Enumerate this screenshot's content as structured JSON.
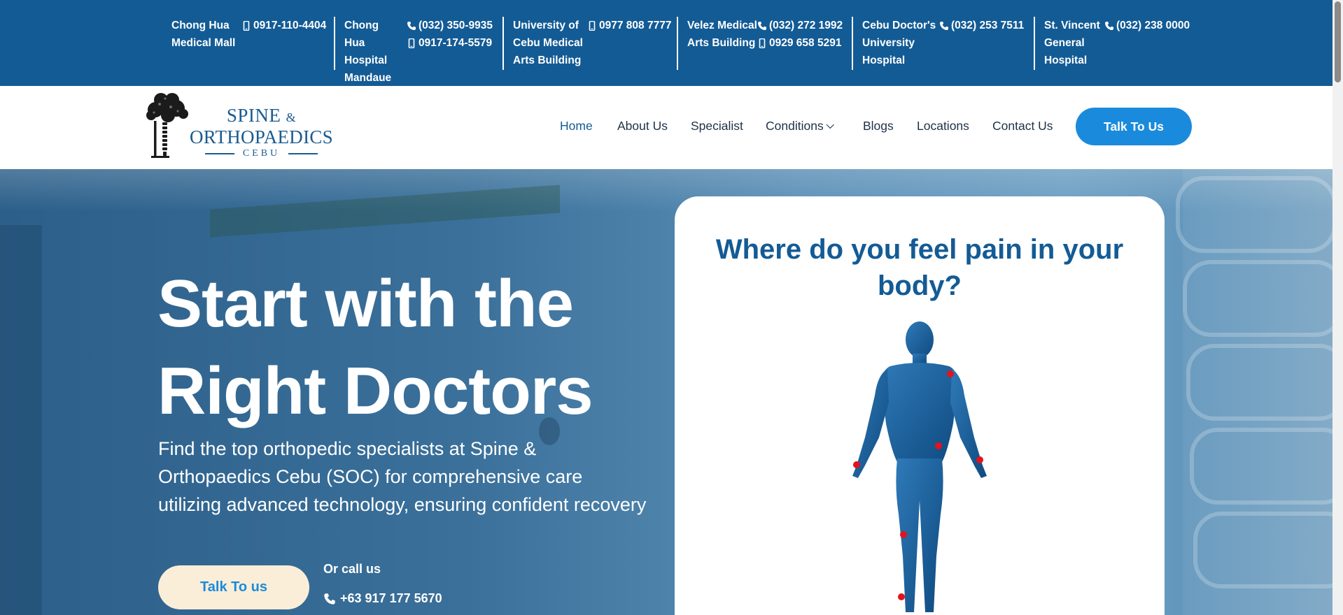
{
  "locations": [
    {
      "name": "Chong Hua Medical Mall",
      "phones": [
        {
          "icon": "mobile-icon",
          "number": "0917-110-4404"
        }
      ]
    },
    {
      "name": "Chong Hua Hospital Mandaue",
      "phones": [
        {
          "icon": "phone-icon",
          "number": "(032) 350-9935"
        },
        {
          "icon": "mobile-icon",
          "number": "0917-174-5579"
        }
      ]
    },
    {
      "name": "University of Cebu Medical Arts Building",
      "phones": [
        {
          "icon": "mobile-icon",
          "number": "0977 808 7777"
        }
      ]
    },
    {
      "name": "Velez Medical Arts Building",
      "phones": [
        {
          "icon": "phone-icon",
          "number": "(032) 272 1992"
        },
        {
          "icon": "mobile-icon",
          "number": "0929 658 5291"
        }
      ]
    },
    {
      "name": "Cebu Doctor's University Hospital",
      "phones": [
        {
          "icon": "phone-icon",
          "number": "(032) 253 7511"
        }
      ]
    },
    {
      "name": "St. Vincent General Hospital",
      "phones": [
        {
          "icon": "phone-icon",
          "number": "(032) 238 0000"
        }
      ]
    }
  ],
  "logo": {
    "line1": "SPINE",
    "amp": "&",
    "line2": "ORTHOPAEDICS",
    "line3": "CEBU"
  },
  "nav": {
    "items": [
      "Home",
      "About Us",
      "Specialist",
      "Conditions",
      "Blogs",
      "Locations",
      "Contact Us"
    ],
    "active": "Home",
    "cta": "Talk To Us"
  },
  "hero": {
    "title_line1": "Start with the",
    "title_line2": "Right Doctors",
    "subtitle": "Find the top orthopedic specialists at Spine & Orthopaedics Cebu (SOC) for comprehensive care utilizing advanced technology, ensuring confident recovery",
    "button": "Talk To us",
    "or_call": "Or call us",
    "phone": "+63 917 177 5670"
  },
  "pain_card": {
    "title": "Where do you feel pain in your body?",
    "marker_color": "#e0141e"
  },
  "colors": {
    "brand": "#135b95",
    "accent": "#1a8bdc",
    "cream": "#fbeed8"
  }
}
